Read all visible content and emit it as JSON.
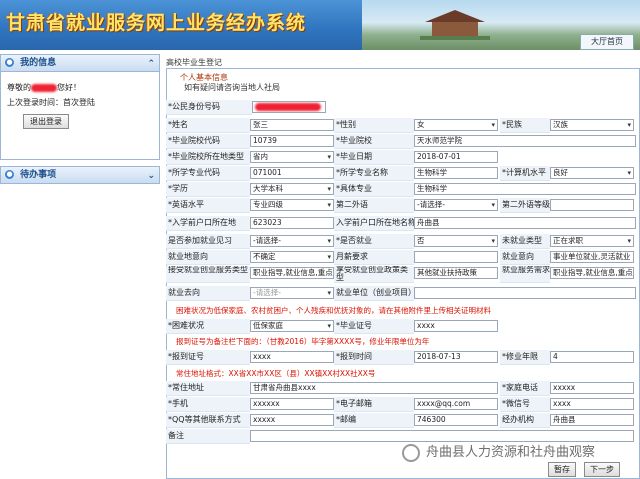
{
  "header": {
    "title": "甘肃省就业服务网上业务经办系统",
    "hall_label": "大厅首页"
  },
  "my_info": {
    "heading": "我的信息",
    "greeting_prefix": "尊敬的",
    "greeting_suffix": "您好！",
    "last_login": "上次登录时间：首次登陆",
    "logout": "退出登录"
  },
  "todo": {
    "heading": "待办事项"
  },
  "breadcrumb": "高校毕业生登记",
  "section": {
    "legend": "个人基本信息",
    "hint": "如有疑问请咨询当地人社局"
  },
  "fields": {
    "id_label": "*公民身份号码",
    "name_label": "*姓名",
    "name_val": "张三",
    "gender_label": "*性别",
    "gender_val": "女",
    "ethnic_label": "*民族",
    "ethnic_val": "汉族",
    "schoolcode_label": "*毕业院校代码",
    "schoolcode_val": "10739",
    "school_label": "*毕业院校",
    "school_val": "天水师范学院",
    "schoolloc_label": "*毕业院校所在地类型",
    "schoolloc_val": "省内",
    "graddate_label": "*毕业日期",
    "graddate_val": "2018-07-01",
    "majorcode_label": "*所学专业代码",
    "majorcode_val": "071001",
    "major_label": "*所学专业名称",
    "major_val": "生物科学",
    "computer_label": "*计算机水平",
    "computer_val": "良好",
    "edu_label": "*学历",
    "edu_val": "大学本科",
    "specific_label": "*具体专业",
    "specific_val": "生物科学",
    "english_label": "*英语水平",
    "english_val": "专业四级",
    "lang2_label": "第二外语",
    "lang2_val": "-请选择-",
    "lang2lvl_label": "第二外语等级",
    "hukoucode_label": "*入学前户口所在地",
    "hukoucode_val": "623023",
    "hukouname_label": "入学前户口所在地名称",
    "hukouname_val": "舟曲县",
    "intern_label": "是否参加就业见习",
    "intern_val": "-请选择-",
    "employed_label": "*是否就业",
    "employed_val": "否",
    "unemp_label": "未就业类型",
    "unemp_val": "正在求职",
    "wish_label": "就业地意向",
    "wish_val": "不确定",
    "salary_label": "月薪要求",
    "jobwish_label": "就业意向",
    "jobwish_val": "事业单位就业,灵活就业",
    "svc_label": "接受就业创业服务类型",
    "svc_val": "职业指导,就业信息,重点",
    "policy_label": "享受就业创业政策类型",
    "policy_val": "其他就业扶持政策",
    "svcneed_label": "就业服务需求",
    "svcneed_val": "职业指导,就业信息,重点",
    "dest_label": "就业去向",
    "dest_val": "-请选择-",
    "unit_label": "就业单位（创业项目）",
    "note1": "困难状况为低保家庭、农村贫困户、个人残疾和优抚对象的，请在其他附件里上传相关证明材料",
    "hardship_label": "*困难状况",
    "hardship_val": "低保家庭",
    "certno_label": "*毕业证号",
    "certno_val": "xxxx",
    "note2": "报到证号为备注栏下面的：（甘教2016）毕字第XXXX号，修业年限单位为年",
    "reportno_label": "*报到证号",
    "reportno_val": "xxxx",
    "reportdate_label": "*报到时间",
    "reportdate_val": "2018-07-13",
    "years_label": "*修业年限",
    "years_val": "4",
    "note3": "常住地址格式：XX省XX市XX区（县）XX镇XX村XX社XX号",
    "addr_label": "*常住地址",
    "addr_val": "甘肃省舟曲县xxxx",
    "homephone_label": "*家庭电话",
    "homephone_val": "xxxxx",
    "mobile_label": "*手机",
    "mobile_val": "xxxxxx",
    "email_label": "*电子邮箱",
    "email_val": "xxxx@qq.com",
    "wechat_label": "*微信号",
    "wechat_val": "xxxx",
    "qq_label": "*QQ等其他联系方式",
    "qq_val": "xxxxx",
    "zip_label": "*邮编",
    "zip_val": "746300",
    "agency_label": "经办机构",
    "agency_val": "舟曲县",
    "remark_label": "备注"
  },
  "buttons": {
    "save": "暂存",
    "next": "下一步"
  },
  "watermark": "舟曲县人力资源和社舟曲观察"
}
